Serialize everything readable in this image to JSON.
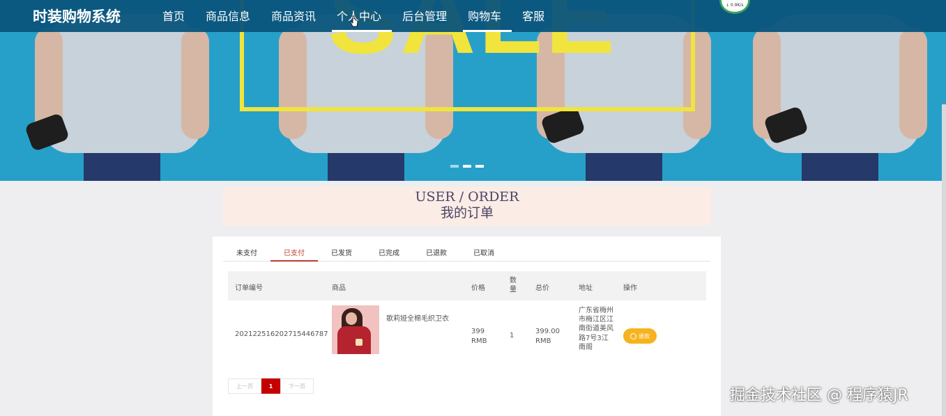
{
  "nav": {
    "brand": "时装购物系统",
    "items": [
      {
        "label": "首页"
      },
      {
        "label": "商品信息"
      },
      {
        "label": "商品资讯"
      },
      {
        "label": "个人中心"
      },
      {
        "label": "后台管理"
      },
      {
        "label": "购物车"
      },
      {
        "label": "客服"
      }
    ],
    "active_indices": [
      3,
      5
    ]
  },
  "banner": {
    "text": "SALE",
    "accent_color": "#f1e43c",
    "bg_color": "#27a0c9"
  },
  "speed_badge": {
    "text": "↓ 0.9K/s"
  },
  "page_title": {
    "en": "USER / ORDER",
    "cn": "我的订单"
  },
  "tabs": [
    {
      "label": "未支付"
    },
    {
      "label": "已支付"
    },
    {
      "label": "已发货"
    },
    {
      "label": "已完成"
    },
    {
      "label": "已退款"
    },
    {
      "label": "已取消"
    }
  ],
  "active_tab": 1,
  "table": {
    "headers": {
      "order_no": "订单编号",
      "product": "商品",
      "price": "价格",
      "qty": "数量",
      "total": "总价",
      "address": "地址",
      "action": "操作"
    },
    "rows": [
      {
        "order_no": "20212251620271544678​7",
        "product_name": "歌莉娅全棉毛织卫衣",
        "price_value": "399",
        "price_unit": "RMB",
        "qty": "1",
        "total_value": "399.00",
        "total_unit": "RMB",
        "address": "广东省梅州市梅江区江南街道美风路7号3江南阁",
        "action_label": "退款"
      }
    ]
  },
  "pager": {
    "prev": "上一页",
    "current": "1",
    "next": "下一页"
  },
  "watermark": "掘金技术社区 @ 程序猿JR"
}
